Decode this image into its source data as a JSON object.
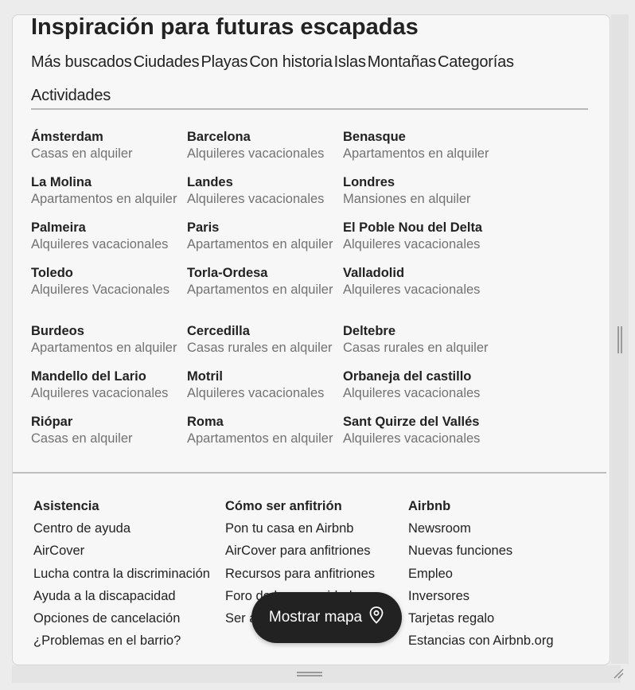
{
  "title": "Inspiración para futuras escapadas",
  "tabs": [
    "Más buscados",
    "Ciudades",
    "Playas",
    "Con historia",
    "Islas",
    "Montañas",
    "Categorías",
    "Actividades"
  ],
  "destinations": [
    [
      {
        "name": "Ámsterdam",
        "sub": "Casas en alquiler"
      },
      {
        "name": "Barcelona",
        "sub": "Alquileres vacacionales"
      },
      {
        "name": "Benasque",
        "sub": "Apartamentos en alquiler"
      }
    ],
    [
      {
        "name": "La Molina",
        "sub": "Apartamentos en alquiler"
      },
      {
        "name": "Landes",
        "sub": "Alquileres vacacionales"
      },
      {
        "name": "Londres",
        "sub": "Mansiones en alquiler"
      }
    ],
    [
      {
        "name": "Palmeira",
        "sub": "Alquileres vacacionales"
      },
      {
        "name": "Paris",
        "sub": "Apartamentos en alquiler"
      },
      {
        "name": "El Poble Nou del Delta",
        "sub": "Alquileres vacacionales"
      }
    ],
    [
      {
        "name": "Toledo",
        "sub": "Alquileres Vacacionales"
      },
      {
        "name": "Torla-Ordesa",
        "sub": "Apartamentos en alquiler"
      },
      {
        "name": "Valladolid",
        "sub": "Alquileres vacacionales"
      }
    ],
    [
      {
        "name": "Burdeos",
        "sub": "Apartamentos en alquiler"
      },
      {
        "name": "Cercedilla",
        "sub": "Casas rurales en alquiler"
      },
      {
        "name": "Deltebre",
        "sub": "Casas rurales en alquiler"
      }
    ],
    [
      {
        "name": "Mandello del Lario",
        "sub": "Alquileres vacacionales"
      },
      {
        "name": "Motril",
        "sub": "Alquileres vacacionales"
      },
      {
        "name": "Orbaneja del castillo",
        "sub": "Alquileres vacacionales"
      }
    ],
    [
      {
        "name": "Riópar",
        "sub": "Casas en alquiler"
      },
      {
        "name": "Roma",
        "sub": "Apartamentos en alquiler"
      },
      {
        "name": "Sant Quirze del Vallés",
        "sub": "Alquileres vacacionales"
      }
    ]
  ],
  "footer": [
    {
      "heading": "Asistencia",
      "links": [
        "Centro de ayuda",
        "AirCover",
        "Lucha contra la discriminación",
        "Ayuda a la discapacidad",
        "Opciones de cancelación",
        "¿Problemas en el barrio?"
      ]
    },
    {
      "heading": "Cómo ser anfitrión",
      "links": [
        "Pon tu casa en Airbnb",
        "AirCover para anfitriones",
        "Recursos para anfitriones",
        "Foro de la comunidad",
        "Ser anfitrión responsable"
      ]
    },
    {
      "heading": "Airbnb",
      "links": [
        "Newsroom",
        "Nuevas funciones",
        "Empleo",
        "Inversores",
        "Tarjetas regalo",
        "Estancias con Airbnb.org"
      ]
    }
  ],
  "map_button": {
    "label": "Mostrar mapa",
    "icon": "map-pin-icon"
  }
}
